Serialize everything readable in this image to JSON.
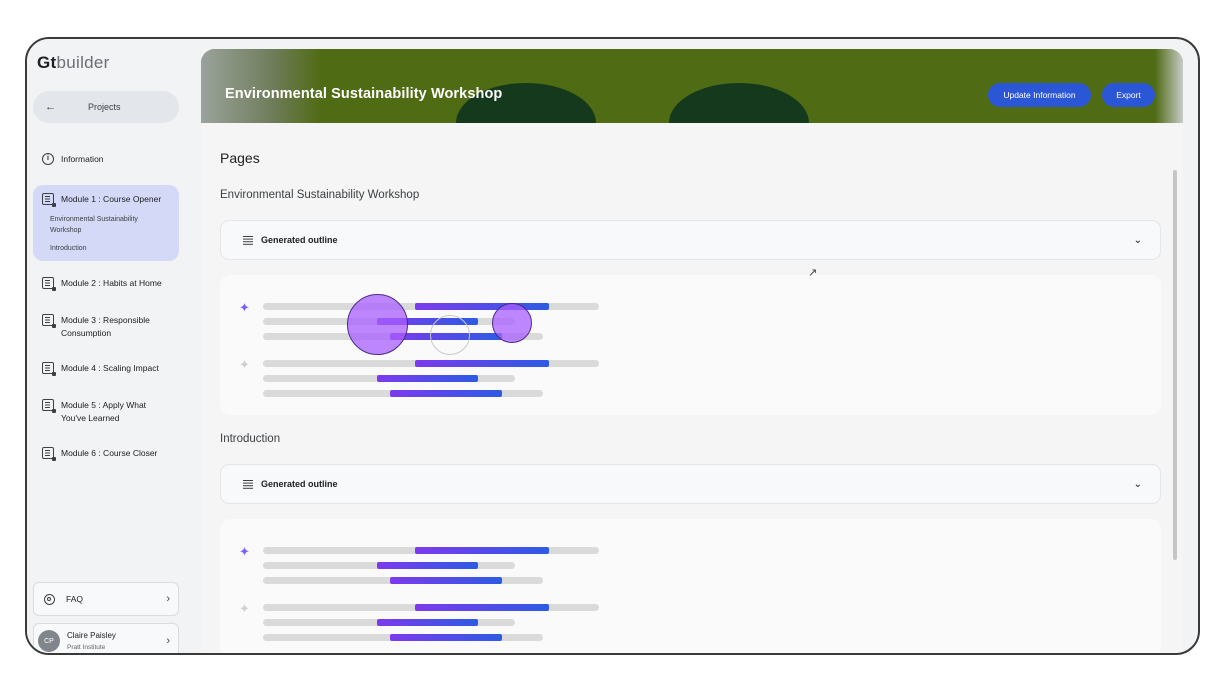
{
  "app": {
    "logo_strong": "Gt",
    "logo_rest": "builder"
  },
  "sidebar": {
    "projects_label": "Projects",
    "information_label": "Information",
    "modules": [
      {
        "label": "Module 1 : Course Opener",
        "active": true,
        "subitems": [
          "Environmental Sustainability Workshop",
          "Introduction"
        ]
      },
      {
        "label": "Module 2 : Habits at Home"
      },
      {
        "label": "Module 3 : Responsible Consumption"
      },
      {
        "label": "Module 4 : Scaling Impact"
      },
      {
        "label": "Module 5 : Apply What You've Learned"
      },
      {
        "label": "Module 6 : Course Closer"
      }
    ],
    "faq_label": "FAQ",
    "user": {
      "initials": "CP",
      "name": "Claire Paisley",
      "org": "Pratt Institute"
    }
  },
  "header": {
    "title": "Environmental Sustainability Workshop",
    "update_label": "Update Information",
    "export_label": "Export"
  },
  "main": {
    "pages_heading": "Pages",
    "sections": [
      {
        "title": "Environmental Sustainability Workshop",
        "outline_label": "Generated outline"
      },
      {
        "title": "Introduction",
        "outline_label": "Generated outline"
      }
    ]
  },
  "colors": {
    "accent": "#2b57d6",
    "active_module_bg": "#d4d9f7",
    "banner": "#4f6b14"
  },
  "icons": [
    "back-arrow-icon",
    "info-icon",
    "module-icon",
    "outline-lines-icon",
    "chevron-down-icon",
    "sparkle-icon",
    "faq-lifebuoy-icon",
    "chevron-right-icon"
  ]
}
